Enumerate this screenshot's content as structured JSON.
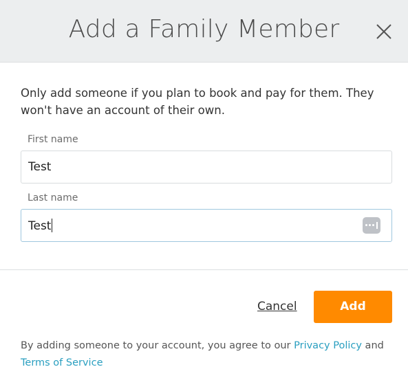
{
  "dialog": {
    "title": "Add a Family Member",
    "close_icon": "close-icon"
  },
  "intro_text": "Only add someone if you plan to book and pay for them. They won't have an account of their own.",
  "fields": {
    "first_name": {
      "label": "First name",
      "value": "Test"
    },
    "last_name": {
      "label": "Last name",
      "value": "Test",
      "autofill_icon": "password-manager-icon"
    }
  },
  "actions": {
    "cancel_label": "Cancel",
    "add_label": "Add"
  },
  "footer": {
    "prefix": "By adding someone to your account, you agree to our ",
    "privacy_label": "Privacy Policy",
    "middle": " and ",
    "terms_label": "Terms of Service"
  },
  "colors": {
    "header_bg": "#eceeef",
    "primary_button": "#ff8a00",
    "link": "#2a9fc0"
  }
}
